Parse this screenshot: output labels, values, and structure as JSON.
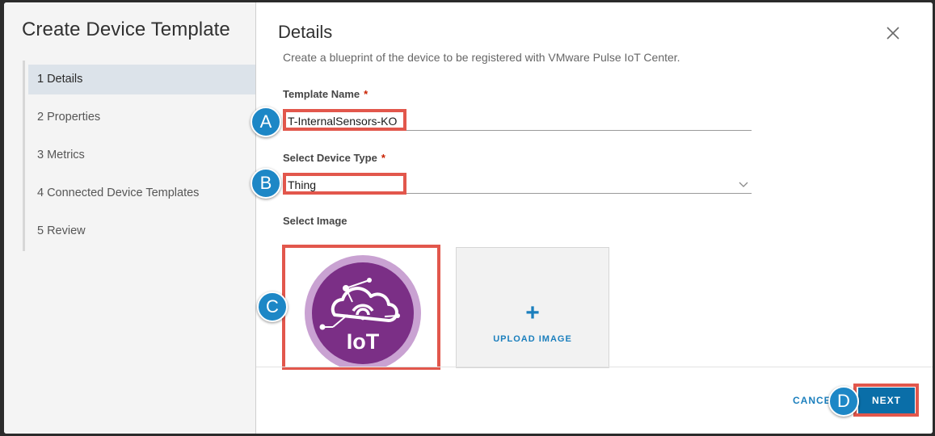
{
  "wizard": {
    "title": "Create Device Template",
    "steps": [
      {
        "num": "1",
        "label": "Details"
      },
      {
        "num": "2",
        "label": "Properties"
      },
      {
        "num": "3",
        "label": "Metrics"
      },
      {
        "num": "4",
        "label": "Connected Device Templates"
      },
      {
        "num": "5",
        "label": "Review"
      }
    ]
  },
  "details": {
    "title": "Details",
    "description": "Create a blueprint of the device to be registered with VMware Pulse IoT Center.",
    "template_name_label": "Template Name",
    "template_name_value": "T-InternalSensors-KO",
    "device_type_label": "Select Device Type",
    "device_type_value": "Thing",
    "required_mark": "*",
    "select_image_label": "Select Image",
    "iot_logo_text": "IoT",
    "upload_plus": "+",
    "upload_label": "UPLOAD IMAGE"
  },
  "footer": {
    "cancel_label": "CANCEL",
    "next_label": "NEXT"
  },
  "annotations": {
    "a": "A",
    "b": "B",
    "c": "C",
    "d": "D",
    "color": "#1d87c6",
    "highlight_color": "#e2574c"
  },
  "colors": {
    "accent": "#1b7fbd",
    "primary_button": "#0a6ea8",
    "iot_purple": "#7b2f86"
  }
}
